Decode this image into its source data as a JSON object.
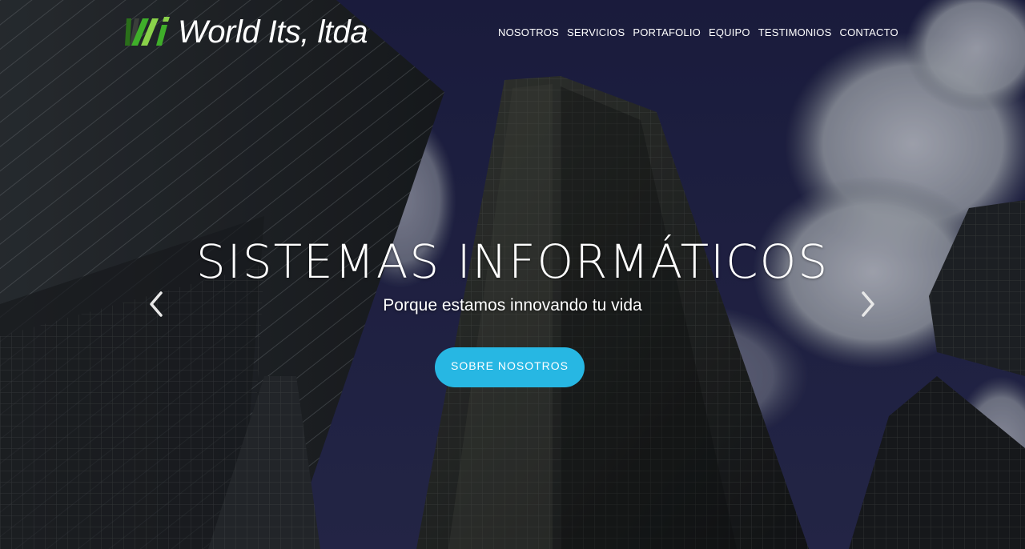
{
  "brand": {
    "name": "World Its, ltda",
    "logo_icon": "wi-logo-icon",
    "logo_colors": [
      "#3fae2a",
      "#8ad24a",
      "#2a6e1a"
    ]
  },
  "nav": {
    "items": [
      {
        "label": "NOSOTROS"
      },
      {
        "label": "SERVICIOS"
      },
      {
        "label": "PORTAFOLIO"
      },
      {
        "label": "EQUIPO"
      },
      {
        "label": "TESTIMONIOS"
      },
      {
        "label": "CONTACTO"
      }
    ]
  },
  "hero": {
    "title": "SISTEMAS INFORMÁTICOS",
    "subtitle": "Porque estamos innovando tu vida",
    "cta_label": "SOBRE NOSOTROS",
    "cta_color": "#27b7e3",
    "background": "city-skyscrapers-photo",
    "prev_icon": "chevron-left-icon",
    "next_icon": "chevron-right-icon"
  }
}
